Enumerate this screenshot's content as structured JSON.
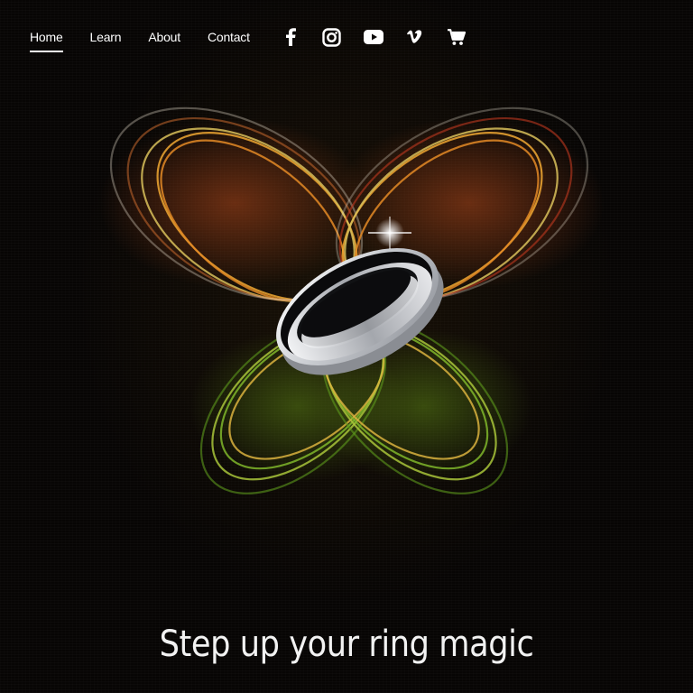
{
  "nav": {
    "items": [
      {
        "label": "Home",
        "active": true
      },
      {
        "label": "Learn",
        "active": false
      },
      {
        "label": "About",
        "active": false
      },
      {
        "label": "Contact",
        "active": false
      }
    ]
  },
  "social": {
    "icons": [
      "facebook-icon",
      "instagram-icon",
      "youtube-icon",
      "vimeo-icon",
      "cart-icon"
    ]
  },
  "hero": {
    "headline": "Step up your ring magic",
    "image": "ring-in-butterfly-light-trail"
  },
  "colors": {
    "background": "#070504",
    "text": "#ffffff",
    "trail_orange": "#e89a2a",
    "trail_red": "#c0391f",
    "trail_green": "#7fb62a"
  }
}
